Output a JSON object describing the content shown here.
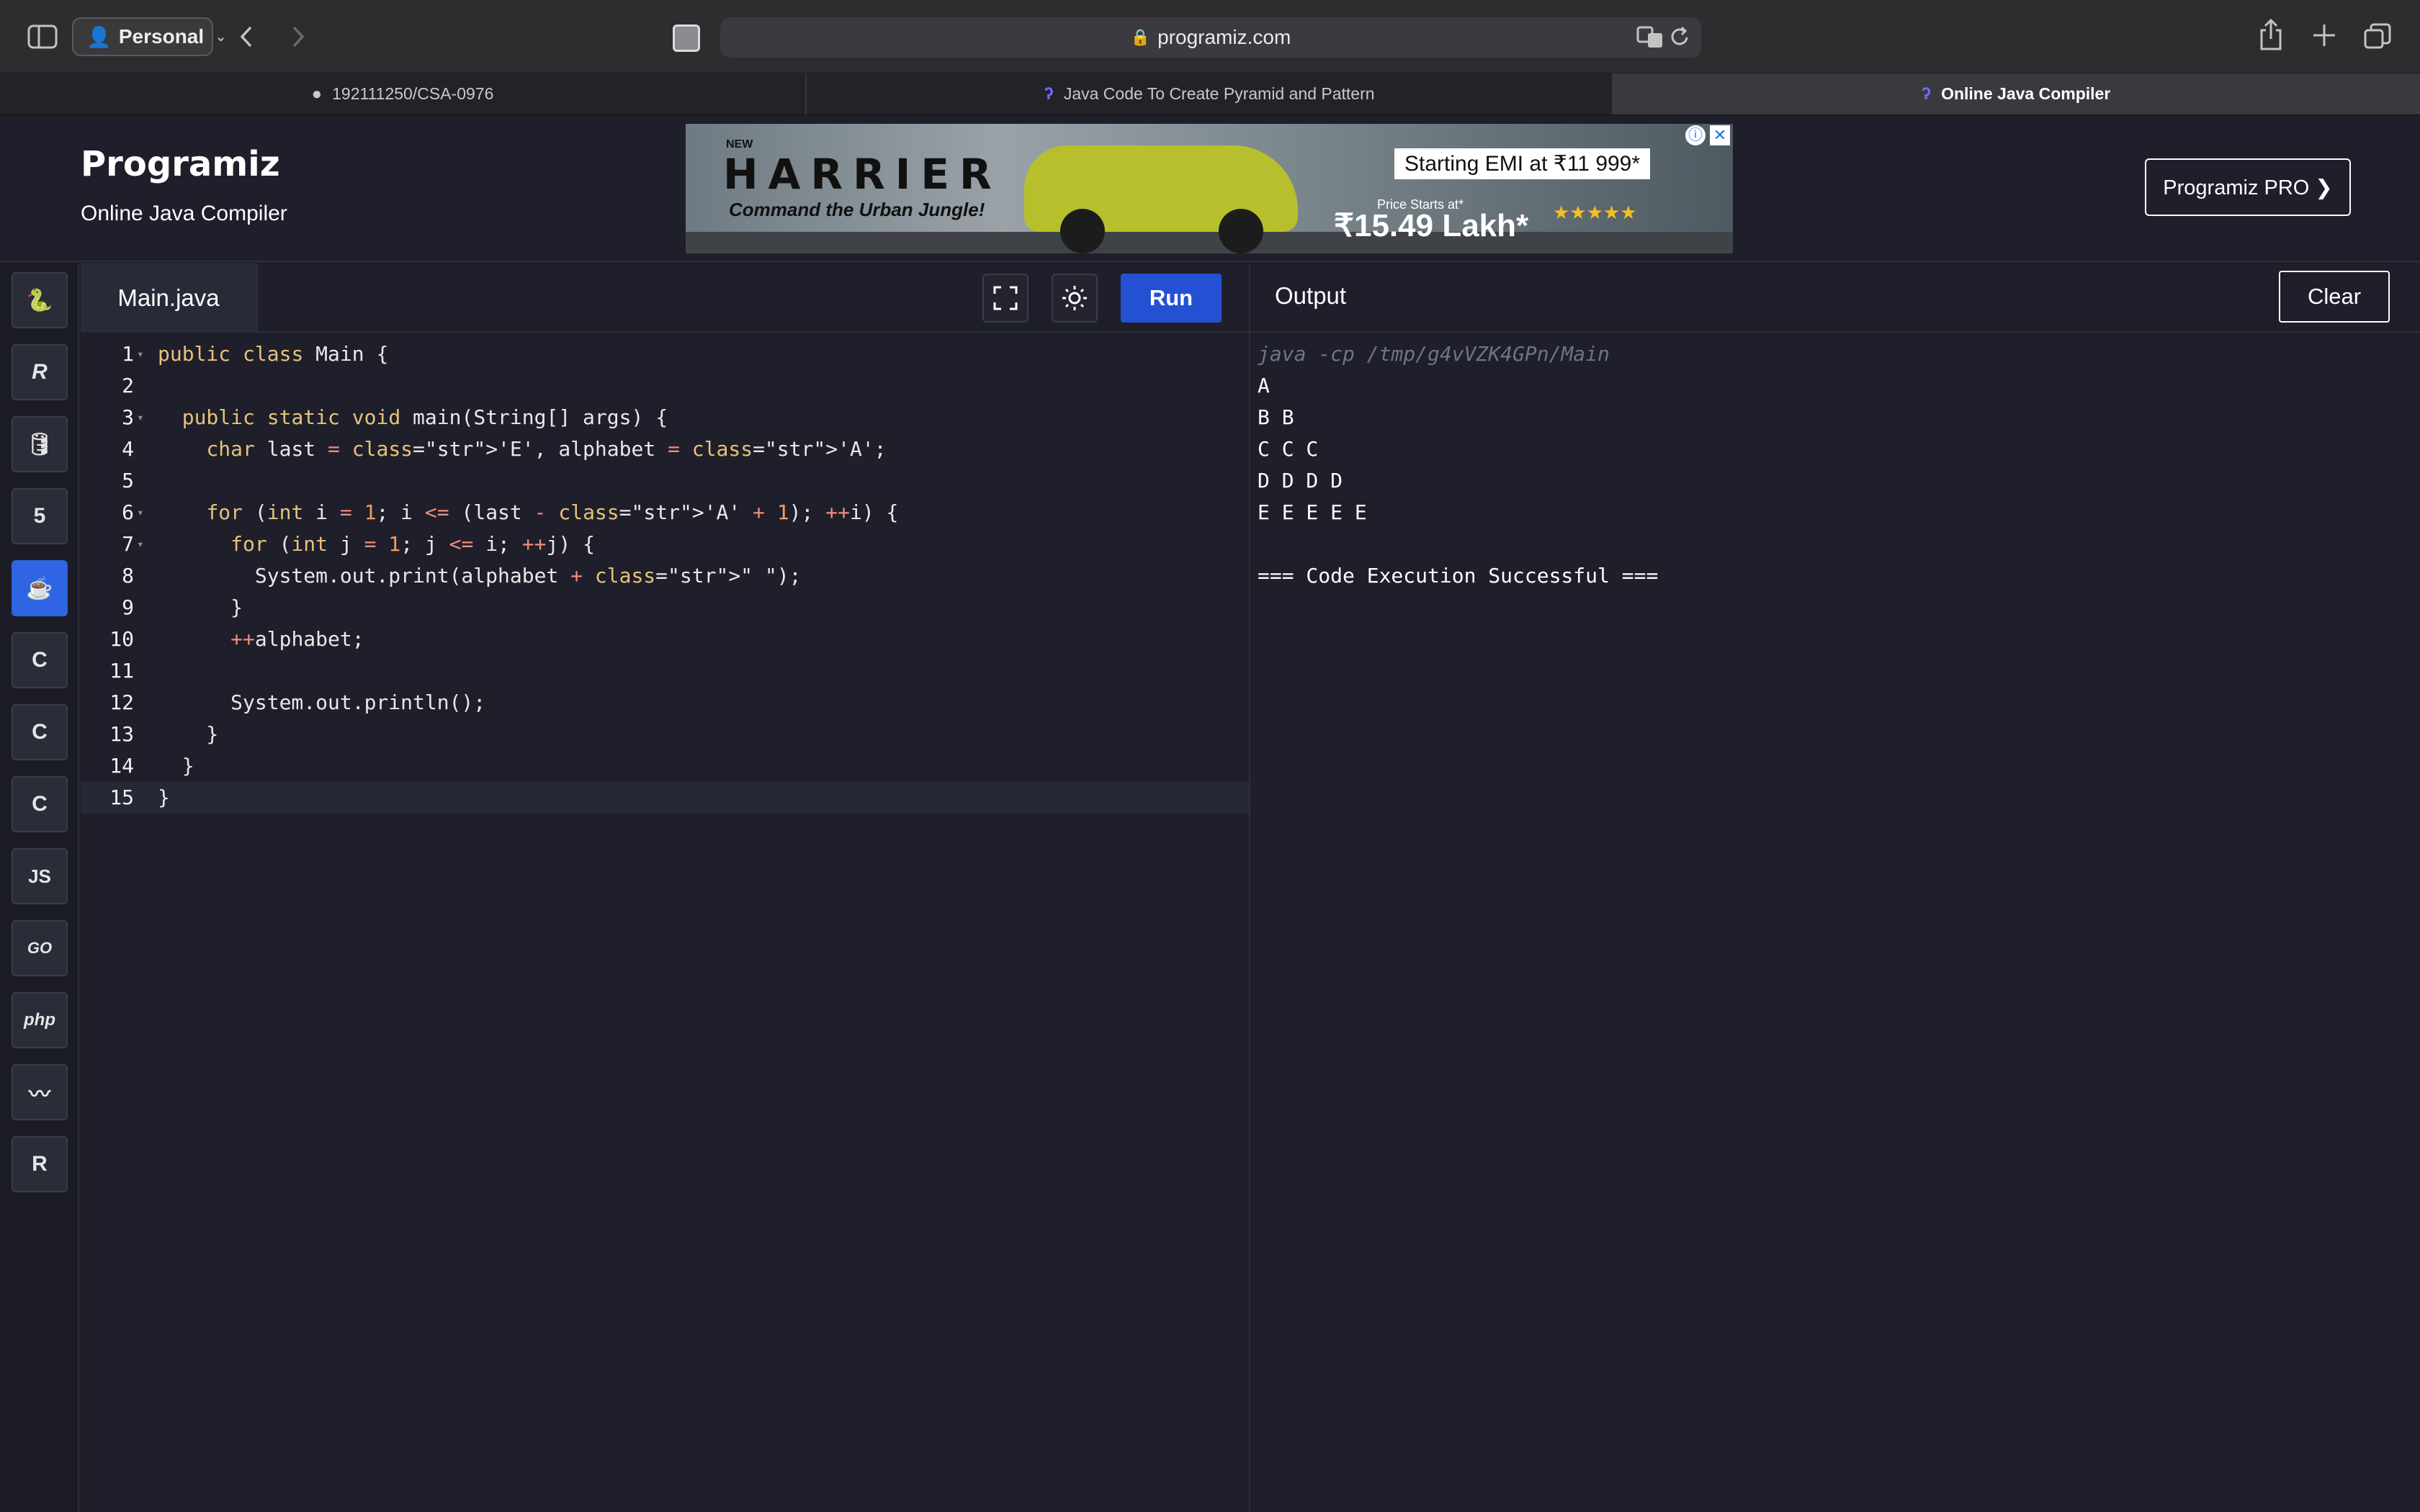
{
  "browser": {
    "profile_label": "Personal",
    "url": "programiz.com",
    "tabs": [
      {
        "label": "192111250/CSA-0976",
        "icon": "github-icon"
      },
      {
        "label": "Java Code To Create Pyramid and Pattern",
        "icon": "programiz-icon"
      },
      {
        "label": "Online Java Compiler",
        "icon": "programiz-icon",
        "active": true
      }
    ]
  },
  "header": {
    "logo": "Programiz",
    "subtitle": "Online Java Compiler",
    "pro_button": "Programiz PRO ❯"
  },
  "ad": {
    "brand_small": "NEW",
    "brand": "HARRIER",
    "tagline": "Command the Urban Jungle!",
    "emi": "Starting EMI at ₹11 999*",
    "price_prefix": "Price Starts at*",
    "price": "₹15.49 Lakh*",
    "stars": "★★★★★"
  },
  "languages": [
    {
      "name": "python-icon",
      "glyph": "🐍"
    },
    {
      "name": "r-icon",
      "glyph": "R"
    },
    {
      "name": "sql-icon",
      "glyph": "🛢"
    },
    {
      "name": "html-icon",
      "glyph": "5"
    },
    {
      "name": "java-icon",
      "glyph": "☕",
      "active": true
    },
    {
      "name": "c-icon",
      "glyph": "C"
    },
    {
      "name": "cpp-icon",
      "glyph": "C"
    },
    {
      "name": "csharp-icon",
      "glyph": "C"
    },
    {
      "name": "javascript-icon",
      "glyph": "JS"
    },
    {
      "name": "go-icon",
      "glyph": "GO"
    },
    {
      "name": "php-icon",
      "glyph": "php"
    },
    {
      "name": "swift-icon",
      "glyph": "〰"
    },
    {
      "name": "rust-icon",
      "glyph": "R"
    }
  ],
  "editor": {
    "filename": "Main.java",
    "run_label": "Run",
    "lines": [
      "public class Main {",
      "",
      "  public static void main(String[] args) {",
      "    char last = 'E', alphabet = 'A';",
      "",
      "    for (int i = 1; i <= (last - 'A' + 1); ++i) {",
      "      for (int j = 1; j <= i; ++j) {",
      "        System.out.print(alphabet + \" \");",
      "      }",
      "      ++alphabet;",
      "",
      "      System.out.println();",
      "    }",
      "  }",
      "}"
    ]
  },
  "output": {
    "title": "Output",
    "clear_label": "Clear",
    "lines": [
      "java -cp /tmp/g4vVZK4GPn/Main",
      "A",
      "B B",
      "C C C",
      "D D D D",
      "E E E E E",
      "",
      "=== Code Execution Successful ==="
    ]
  }
}
